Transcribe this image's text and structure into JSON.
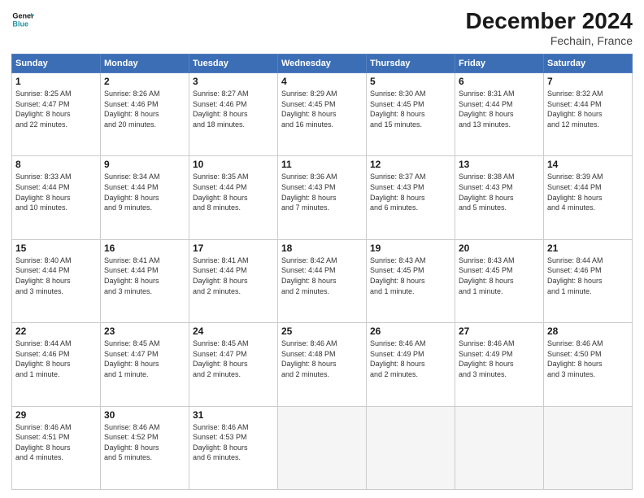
{
  "logo": {
    "line1": "General",
    "line2": "Blue"
  },
  "title": "December 2024",
  "location": "Fechain, France",
  "header": {
    "days": [
      "Sunday",
      "Monday",
      "Tuesday",
      "Wednesday",
      "Thursday",
      "Friday",
      "Saturday"
    ]
  },
  "weeks": [
    [
      {
        "day": "1",
        "info": "Sunrise: 8:25 AM\nSunset: 4:47 PM\nDaylight: 8 hours\nand 22 minutes."
      },
      {
        "day": "2",
        "info": "Sunrise: 8:26 AM\nSunset: 4:46 PM\nDaylight: 8 hours\nand 20 minutes."
      },
      {
        "day": "3",
        "info": "Sunrise: 8:27 AM\nSunset: 4:46 PM\nDaylight: 8 hours\nand 18 minutes."
      },
      {
        "day": "4",
        "info": "Sunrise: 8:29 AM\nSunset: 4:45 PM\nDaylight: 8 hours\nand 16 minutes."
      },
      {
        "day": "5",
        "info": "Sunrise: 8:30 AM\nSunset: 4:45 PM\nDaylight: 8 hours\nand 15 minutes."
      },
      {
        "day": "6",
        "info": "Sunrise: 8:31 AM\nSunset: 4:44 PM\nDaylight: 8 hours\nand 13 minutes."
      },
      {
        "day": "7",
        "info": "Sunrise: 8:32 AM\nSunset: 4:44 PM\nDaylight: 8 hours\nand 12 minutes."
      }
    ],
    [
      {
        "day": "8",
        "info": "Sunrise: 8:33 AM\nSunset: 4:44 PM\nDaylight: 8 hours\nand 10 minutes."
      },
      {
        "day": "9",
        "info": "Sunrise: 8:34 AM\nSunset: 4:44 PM\nDaylight: 8 hours\nand 9 minutes."
      },
      {
        "day": "10",
        "info": "Sunrise: 8:35 AM\nSunset: 4:44 PM\nDaylight: 8 hours\nand 8 minutes."
      },
      {
        "day": "11",
        "info": "Sunrise: 8:36 AM\nSunset: 4:43 PM\nDaylight: 8 hours\nand 7 minutes."
      },
      {
        "day": "12",
        "info": "Sunrise: 8:37 AM\nSunset: 4:43 PM\nDaylight: 8 hours\nand 6 minutes."
      },
      {
        "day": "13",
        "info": "Sunrise: 8:38 AM\nSunset: 4:43 PM\nDaylight: 8 hours\nand 5 minutes."
      },
      {
        "day": "14",
        "info": "Sunrise: 8:39 AM\nSunset: 4:44 PM\nDaylight: 8 hours\nand 4 minutes."
      }
    ],
    [
      {
        "day": "15",
        "info": "Sunrise: 8:40 AM\nSunset: 4:44 PM\nDaylight: 8 hours\nand 3 minutes."
      },
      {
        "day": "16",
        "info": "Sunrise: 8:41 AM\nSunset: 4:44 PM\nDaylight: 8 hours\nand 3 minutes."
      },
      {
        "day": "17",
        "info": "Sunrise: 8:41 AM\nSunset: 4:44 PM\nDaylight: 8 hours\nand 2 minutes."
      },
      {
        "day": "18",
        "info": "Sunrise: 8:42 AM\nSunset: 4:44 PM\nDaylight: 8 hours\nand 2 minutes."
      },
      {
        "day": "19",
        "info": "Sunrise: 8:43 AM\nSunset: 4:45 PM\nDaylight: 8 hours\nand 1 minute."
      },
      {
        "day": "20",
        "info": "Sunrise: 8:43 AM\nSunset: 4:45 PM\nDaylight: 8 hours\nand 1 minute."
      },
      {
        "day": "21",
        "info": "Sunrise: 8:44 AM\nSunset: 4:46 PM\nDaylight: 8 hours\nand 1 minute."
      }
    ],
    [
      {
        "day": "22",
        "info": "Sunrise: 8:44 AM\nSunset: 4:46 PM\nDaylight: 8 hours\nand 1 minute."
      },
      {
        "day": "23",
        "info": "Sunrise: 8:45 AM\nSunset: 4:47 PM\nDaylight: 8 hours\nand 1 minute."
      },
      {
        "day": "24",
        "info": "Sunrise: 8:45 AM\nSunset: 4:47 PM\nDaylight: 8 hours\nand 2 minutes."
      },
      {
        "day": "25",
        "info": "Sunrise: 8:46 AM\nSunset: 4:48 PM\nDaylight: 8 hours\nand 2 minutes."
      },
      {
        "day": "26",
        "info": "Sunrise: 8:46 AM\nSunset: 4:49 PM\nDaylight: 8 hours\nand 2 minutes."
      },
      {
        "day": "27",
        "info": "Sunrise: 8:46 AM\nSunset: 4:49 PM\nDaylight: 8 hours\nand 3 minutes."
      },
      {
        "day": "28",
        "info": "Sunrise: 8:46 AM\nSunset: 4:50 PM\nDaylight: 8 hours\nand 3 minutes."
      }
    ],
    [
      {
        "day": "29",
        "info": "Sunrise: 8:46 AM\nSunset: 4:51 PM\nDaylight: 8 hours\nand 4 minutes."
      },
      {
        "day": "30",
        "info": "Sunrise: 8:46 AM\nSunset: 4:52 PM\nDaylight: 8 hours\nand 5 minutes."
      },
      {
        "day": "31",
        "info": "Sunrise: 8:46 AM\nSunset: 4:53 PM\nDaylight: 8 hours\nand 6 minutes."
      },
      {
        "day": "",
        "info": ""
      },
      {
        "day": "",
        "info": ""
      },
      {
        "day": "",
        "info": ""
      },
      {
        "day": "",
        "info": ""
      }
    ]
  ]
}
